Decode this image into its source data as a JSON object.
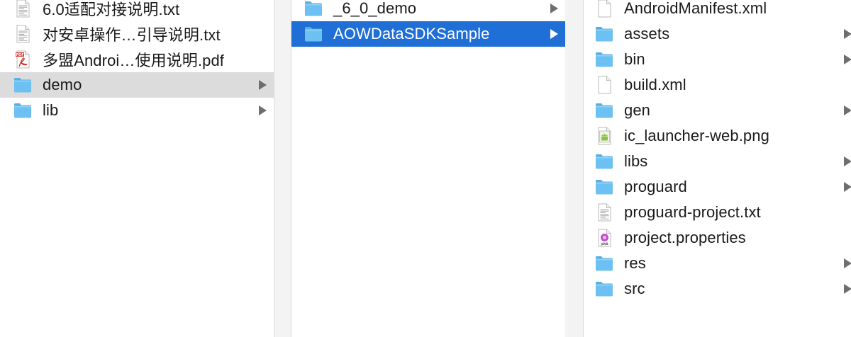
{
  "columns": [
    {
      "items": [
        {
          "name": "6.0适配对接说明.txt",
          "icon": "text-file-icon",
          "kind": "txt",
          "arrow": false
        },
        {
          "name": "对安卓操作…引导说明.txt",
          "icon": "text-file-icon",
          "kind": "txt",
          "arrow": false
        },
        {
          "name": "多盟Androi…使用说明.pdf",
          "icon": "pdf-file-icon",
          "kind": "pdf",
          "arrow": false
        },
        {
          "name": "demo",
          "icon": "folder-icon",
          "kind": "folder",
          "arrow": true,
          "state": "active"
        },
        {
          "name": "lib",
          "icon": "folder-icon",
          "kind": "folder",
          "arrow": true
        }
      ]
    },
    {
      "items": [
        {
          "name": "_6_0_demo",
          "icon": "folder-icon",
          "kind": "folder",
          "arrow": true
        },
        {
          "name": "AOWDataSDKSample",
          "icon": "folder-icon",
          "kind": "folder",
          "arrow": true,
          "state": "selected"
        }
      ]
    },
    {
      "items": [
        {
          "name": "AndroidManifest.xml",
          "icon": "blank-file-icon",
          "kind": "blank",
          "arrow": false
        },
        {
          "name": "assets",
          "icon": "folder-icon",
          "kind": "folder",
          "arrow": true
        },
        {
          "name": "bin",
          "icon": "folder-icon",
          "kind": "folder",
          "arrow": true
        },
        {
          "name": "build.xml",
          "icon": "blank-file-icon",
          "kind": "blank",
          "arrow": false
        },
        {
          "name": "gen",
          "icon": "folder-icon",
          "kind": "folder",
          "arrow": true
        },
        {
          "name": "ic_launcher-web.png",
          "icon": "android-image-icon",
          "kind": "android",
          "arrow": false
        },
        {
          "name": "libs",
          "icon": "folder-icon",
          "kind": "folder",
          "arrow": true
        },
        {
          "name": "proguard",
          "icon": "folder-icon",
          "kind": "folder",
          "arrow": true
        },
        {
          "name": "proguard-project.txt",
          "icon": "text-file-icon",
          "kind": "txt",
          "arrow": false
        },
        {
          "name": "project.properties",
          "icon": "java-properties-icon",
          "kind": "java",
          "arrow": false
        },
        {
          "name": "res",
          "icon": "folder-icon",
          "kind": "folder",
          "arrow": true
        },
        {
          "name": "src",
          "icon": "folder-icon",
          "kind": "folder",
          "arrow": true
        }
      ]
    }
  ],
  "icon_labels": {
    "pdf": "PDF",
    "java": "JAVA"
  },
  "colors": {
    "selection": "#1f6fd6",
    "inactive_selection": "#dcdcdc",
    "folder": "#62b8ec"
  }
}
